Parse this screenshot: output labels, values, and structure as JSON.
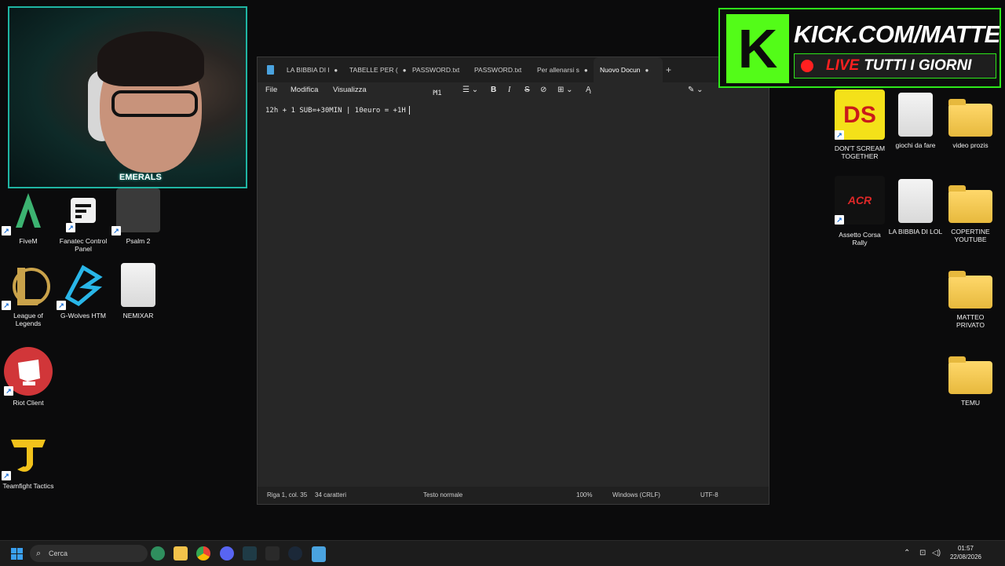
{
  "desktop": {
    "left_icons": [
      {
        "label": "FiveM",
        "icon": "fivem-icon",
        "color": "#2e8b57"
      },
      {
        "label": "Fanatec Control Panel",
        "icon": "fanatec-icon",
        "color": "#1b1b1b"
      },
      {
        "label": "Psalm 2",
        "icon": "psalm-icon",
        "color": "#3a3a3a"
      },
      {
        "label": "League of Legends",
        "icon": "league-icon",
        "color": "#1f3b46"
      },
      {
        "label": "G-Wolves HTM",
        "icon": "gwolves-icon",
        "color": "#0f1a22"
      },
      {
        "label": "NEMIXAR",
        "icon": "file-icon",
        "color": "#e6e6e6"
      },
      {
        "label": "Riot Client",
        "icon": "riot-icon",
        "color": "#d13639"
      },
      {
        "label": "Teamfight Tactics",
        "icon": "tft-icon",
        "color": "#1a1a1a"
      }
    ],
    "right_icons": [
      {
        "label": "DON'T SCREAM TOGETHER",
        "icon": "ds-icon",
        "color": "#f4e119"
      },
      {
        "label": "giochi da fare",
        "icon": "file-icon"
      },
      {
        "label": "video prozis",
        "icon": "folder-icon"
      },
      {
        "label": "Assetto Corsa Rally",
        "icon": "acr-icon",
        "color": "#111111"
      },
      {
        "label": "LA BIBBIA DI LOL",
        "icon": "file-icon"
      },
      {
        "label": "COPERTINE YOUTUBE",
        "icon": "folder-icon"
      },
      {
        "label": "MATTEO PRIVATO",
        "icon": "folder-icon"
      },
      {
        "label": "TEMU",
        "icon": "folder-icon"
      }
    ]
  },
  "webcam": {
    "badge": "EMERALS"
  },
  "banner": {
    "line1": "KICK.COM/MATTEOHS",
    "live": "LIVE",
    "line2_rest": "TUTTI I GIORNI",
    "accent": "#53fc18"
  },
  "notepad": {
    "tabs": [
      {
        "label": "LA BIBBIA DI l",
        "modified": true
      },
      {
        "label": "TABELLE PER (",
        "modified": true
      },
      {
        "label": "PASSWORD.txt",
        "modified": false
      },
      {
        "label": "PASSWORD.txt",
        "modified": false
      },
      {
        "label": "Per allenarsi s",
        "modified": true
      },
      {
        "label": "Nuovo Docun",
        "modified": true,
        "active": true
      }
    ],
    "add_tab": "+",
    "menu": {
      "file": "File",
      "edit": "Modifica",
      "view": "Visualizza"
    },
    "toolbar": {
      "heading": "H1"
    },
    "content": "12h + 1 SUB=+30MIN | 10euro = +1H",
    "status": {
      "position": "Riga 1, col. 35",
      "chars": "34 caratteri",
      "style": "Testo normale",
      "zoom": "100%",
      "eol": "Windows (CRLF)",
      "encoding": "UTF-8"
    }
  },
  "taskbar": {
    "search_placeholder": "Cerca",
    "time": "01:57",
    "date": "22/08/2026"
  }
}
